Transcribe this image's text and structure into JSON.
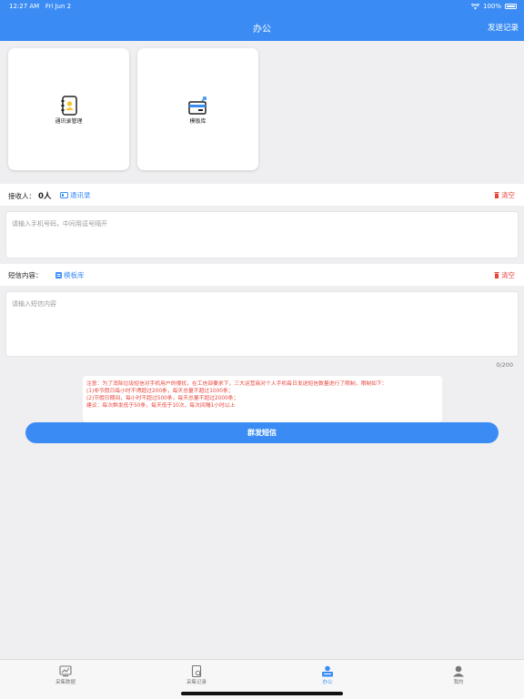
{
  "status": {
    "time": "12:27 AM",
    "date": "Fri Jun 2",
    "battery": "100%"
  },
  "nav": {
    "title": "办公",
    "right_link": "发送记录"
  },
  "tiles": [
    {
      "label": "通讯录管理",
      "icon": "address-book-icon"
    },
    {
      "label": "模板库",
      "icon": "template-library-icon"
    }
  ],
  "recipients": {
    "label": "接收人：",
    "count": "0人",
    "contacts_link": "通讯录",
    "clear": "清空",
    "placeholder": "请输入手机号码，中间用逗号隔开"
  },
  "sms": {
    "label": "短信内容：",
    "template_link": "模板库",
    "clear": "清空",
    "placeholder": "请输入短信内容",
    "counter": "0/200"
  },
  "notice": {
    "lines": [
      "注意：为了消除垃圾短信对手机用户的侵扰，在工信部要求下，三大运营商对个人手机每日发送短信数量进行了限制，限制如下：",
      "(1)非节假日每小时不得超过200条，每天总量不超过1000条；",
      "(2)节假日期间，每小时不超过500条，每天总量不超过2000条；",
      "建议：每次群发低于50条，每天低于10次，每次间隔1小时以上"
    ]
  },
  "send_button": "群发短信",
  "tabbar": {
    "items": [
      {
        "label": "采集数据",
        "icon": "chart-icon"
      },
      {
        "label": "采集记录",
        "icon": "record-icon"
      },
      {
        "label": "办公",
        "icon": "office-icon",
        "active": true
      },
      {
        "label": "我的",
        "icon": "profile-icon"
      }
    ]
  },
  "colors": {
    "accent": "#3a8cf4",
    "danger": "#e8453c",
    "background": "#efeff1"
  }
}
